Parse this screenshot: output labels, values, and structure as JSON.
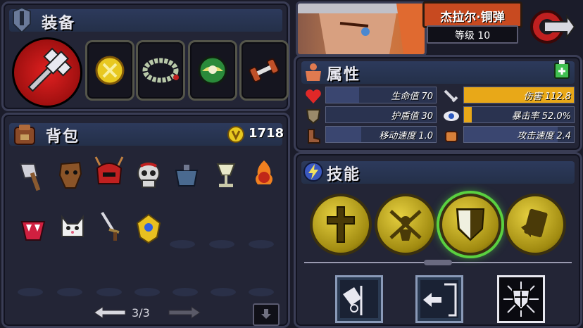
{
  "equipment": {
    "title": "装备"
  },
  "character": {
    "name": "杰拉尔·铜弹",
    "level": "等级 10"
  },
  "attributes": {
    "title": "属性",
    "stats": [
      {
        "label": "生命值 70",
        "fill": 0.3,
        "color": "#2a3350"
      },
      {
        "label": "伤害 112.8",
        "fill": 1.0,
        "color": "#e8a818"
      },
      {
        "label": "护盾值 30",
        "fill": 0.0,
        "color": "#2a3350"
      },
      {
        "label": "暴击率 52.0%",
        "fill": 0.07,
        "color": "#e8a818"
      },
      {
        "label": "移动速度 1.0",
        "fill": 0.32,
        "color": "#2a3350"
      },
      {
        "label": "攻击速度 2.4",
        "fill": 0.85,
        "color": "#2a3350"
      }
    ]
  },
  "backpack": {
    "title": "背包",
    "gold": "1718",
    "page": "3/3"
  },
  "skills": {
    "title": "技能"
  }
}
